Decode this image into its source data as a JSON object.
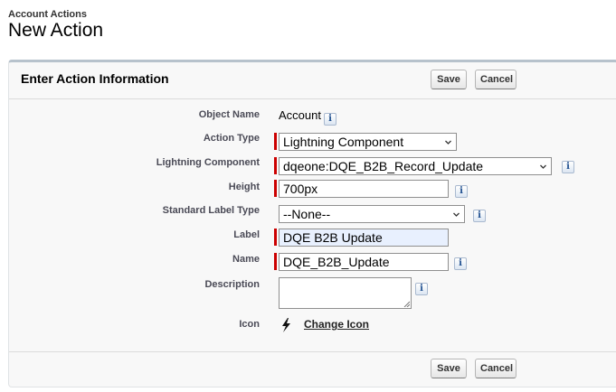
{
  "header": {
    "breadcrumb": "Account Actions",
    "title": "New Action"
  },
  "panel": {
    "title": "Enter Action Information",
    "save_label": "Save",
    "cancel_label": "Cancel"
  },
  "form": {
    "object_name": {
      "label": "Object Name",
      "value": "Account"
    },
    "action_type": {
      "label": "Action Type",
      "value": "Lightning Component"
    },
    "lightning_component": {
      "label": "Lightning Component",
      "value": "dqeone:DQE_B2B_Record_Update"
    },
    "height": {
      "label": "Height",
      "value": "700px"
    },
    "standard_label_type": {
      "label": "Standard Label Type",
      "value": "--None--"
    },
    "label": {
      "label": "Label",
      "value": "DQE B2B Update"
    },
    "name": {
      "label": "Name",
      "value": "DQE_B2B_Update"
    },
    "description": {
      "label": "Description",
      "value": ""
    },
    "icon": {
      "label": "Icon",
      "link": "Change Icon"
    }
  },
  "icons": {
    "info": "i",
    "lightning": "lightning-bolt-icon"
  },
  "colors": {
    "required": "#cc0000",
    "panel_border": "#b7c2cc",
    "label_text": "#4a4a56"
  }
}
